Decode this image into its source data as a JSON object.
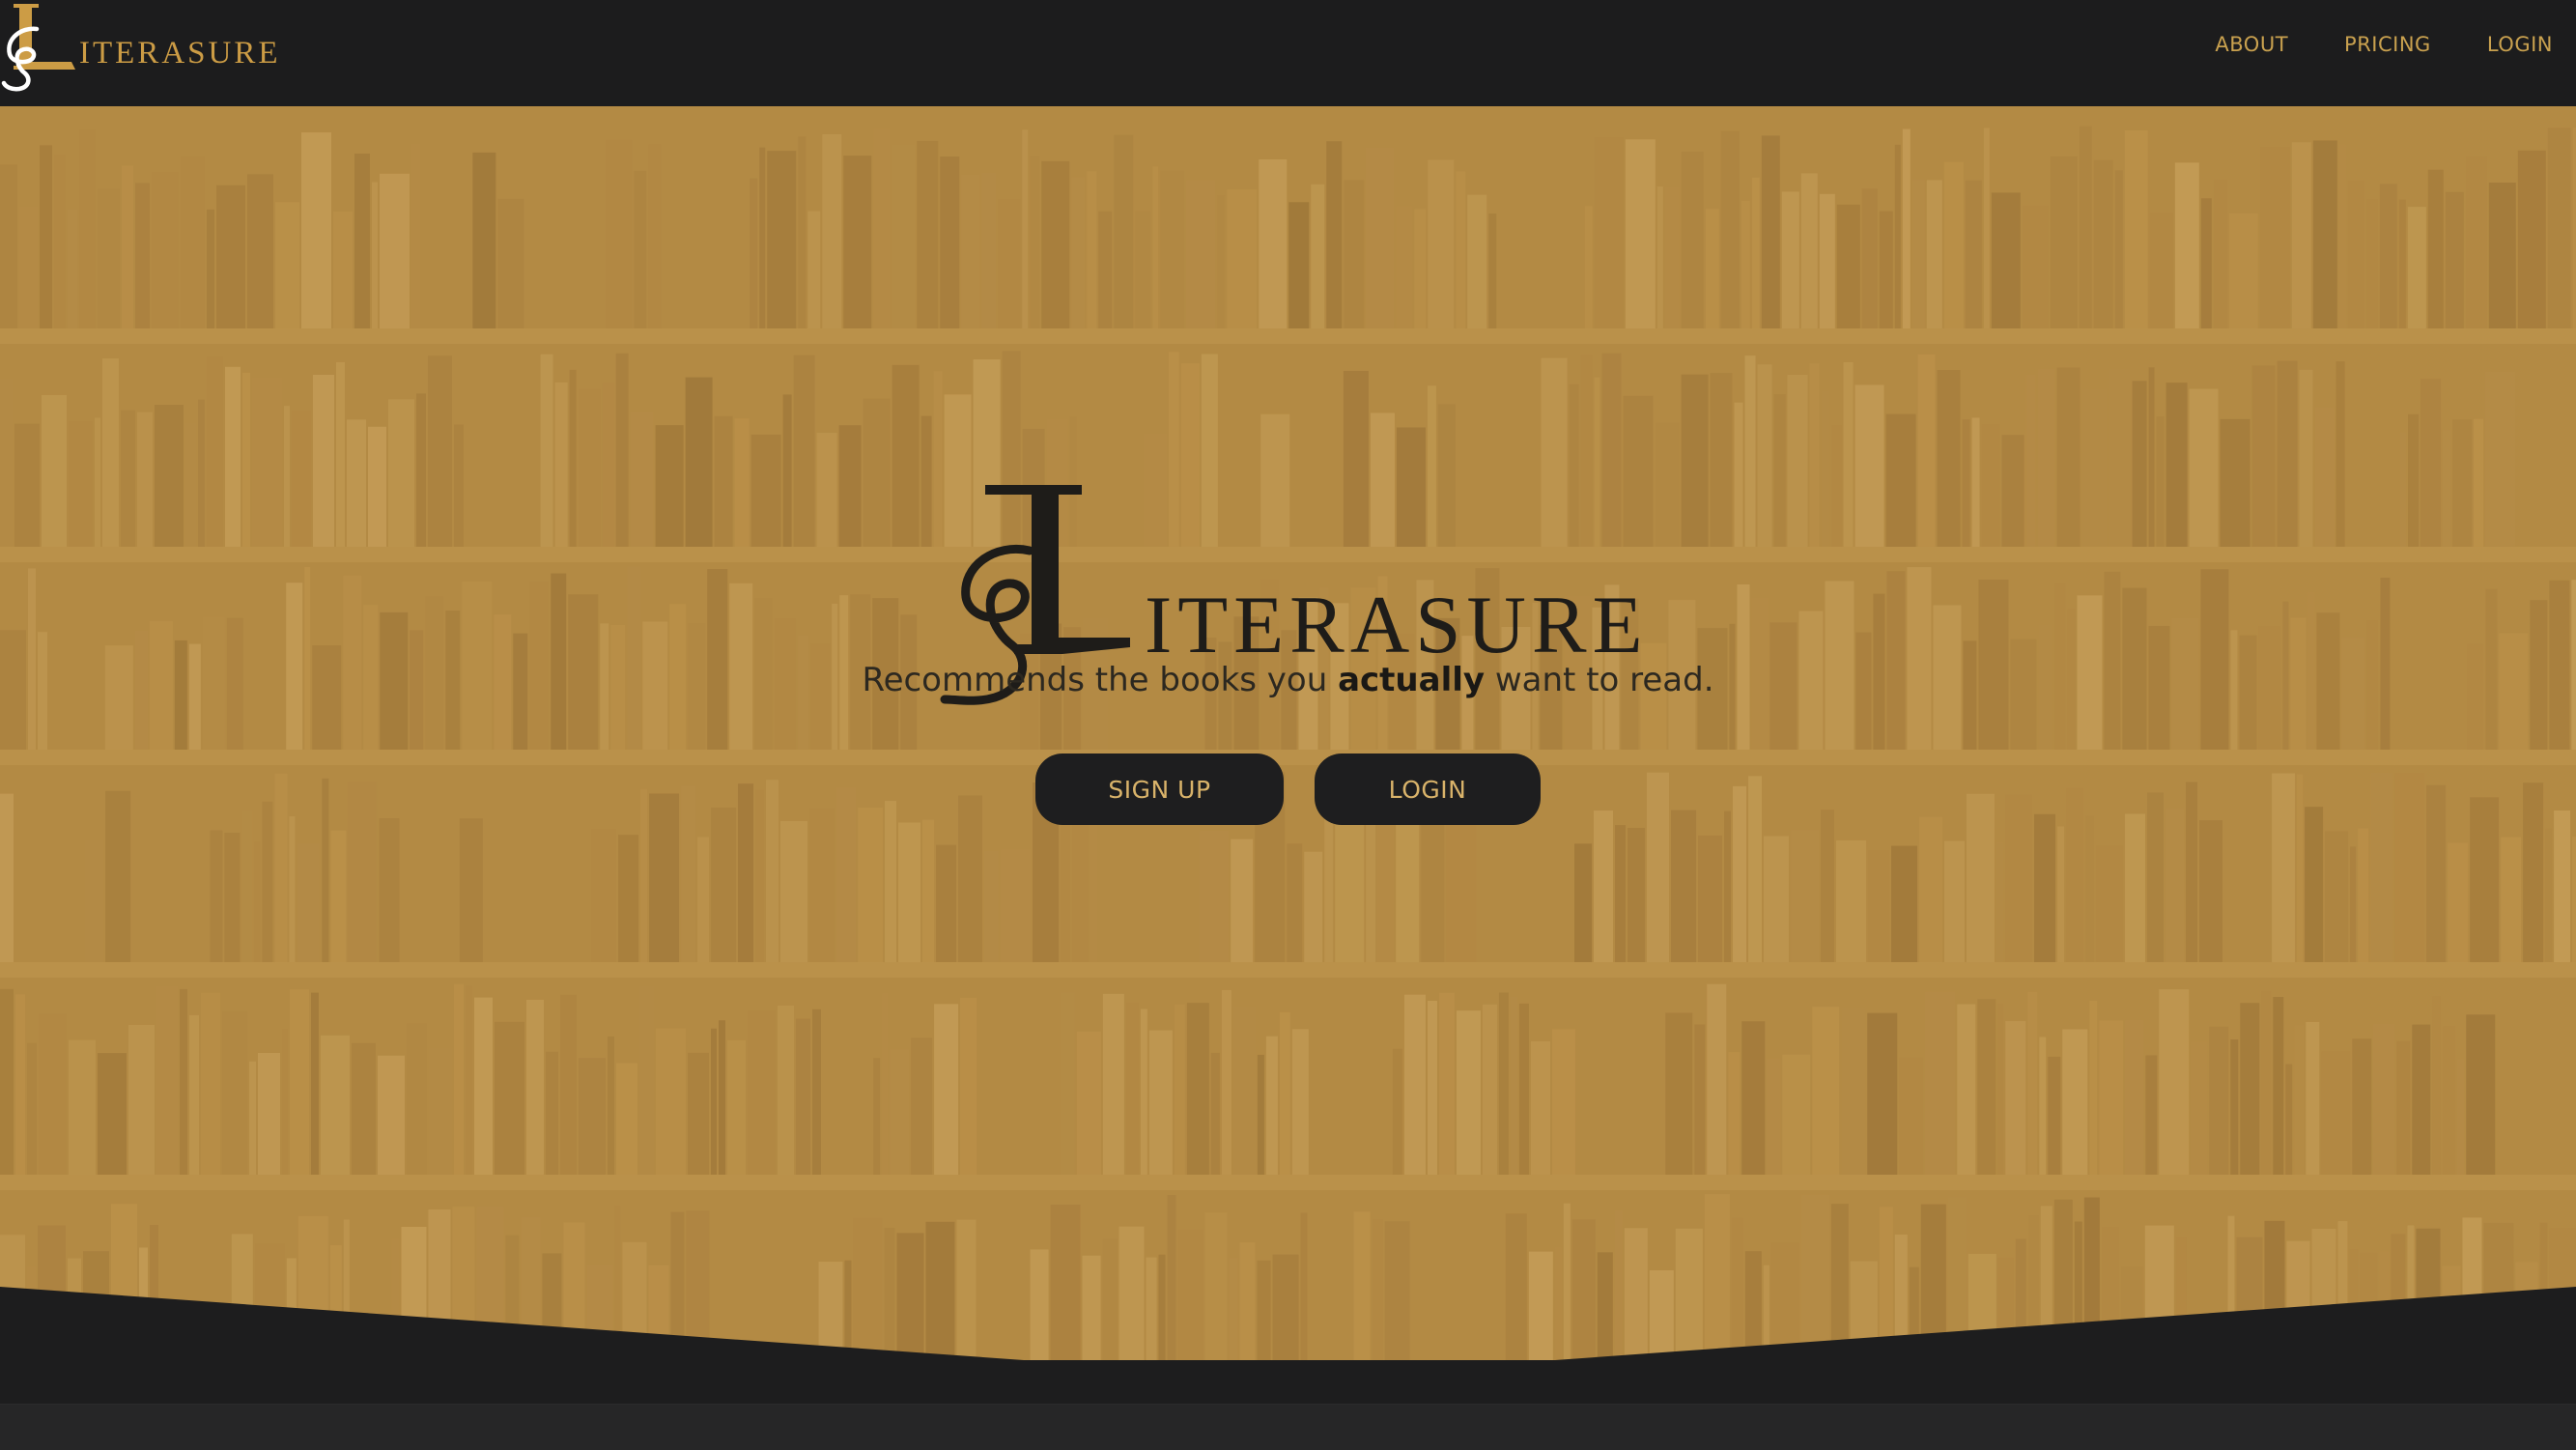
{
  "brand": {
    "logo_letter": "L",
    "logo_word": "ITERASURE",
    "logo_icon": "literasure-monogram-icon"
  },
  "nav": {
    "items": [
      {
        "label": "ABOUT"
      },
      {
        "label": "PRICING"
      },
      {
        "label": "LOGIN"
      }
    ]
  },
  "hero": {
    "logo_word": "ITERASURE",
    "tagline_before": "Recommends the books you ",
    "tagline_emphasis": "actually",
    "tagline_after": " want to read.",
    "signup_label": "SIGN UP",
    "login_label": "LOGIN",
    "background": "bookshelf-photo"
  },
  "colors": {
    "gold": "#cc9c45",
    "hero_tint": "#b38a44",
    "dark": "#1c1c1d",
    "button_text": "#d9b36a"
  }
}
